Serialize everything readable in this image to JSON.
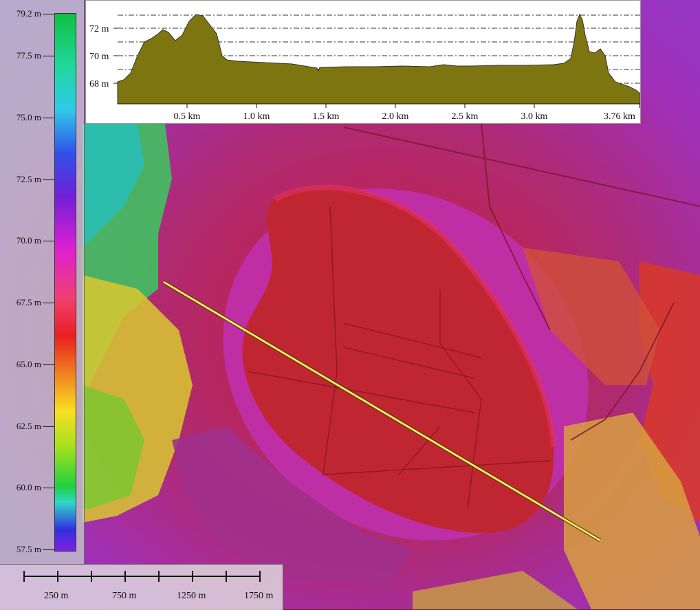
{
  "legend": {
    "ticks": [
      "79.2 m",
      "77.5 m",
      "75.0 m",
      "72.5 m",
      "70.0 m",
      "67.5 m",
      "65.0 m",
      "62.5 m",
      "60.0 m",
      "57.5 m"
    ]
  },
  "profile": {
    "y_labels": [
      "72 m",
      "70 m",
      "68 m"
    ],
    "x_labels": [
      "0.5 km",
      "1.0 km",
      "1.5 km",
      "2.0 km",
      "2.5 km",
      "3.0 km",
      "3.76 km"
    ]
  },
  "scalebar": {
    "labels": [
      "250 m",
      "750 m",
      "1250 m",
      "1750 m"
    ]
  },
  "colors": {
    "profile_fill": "#7d7510",
    "profile_line": "#333333",
    "transect_line": "#f5e860"
  }
}
